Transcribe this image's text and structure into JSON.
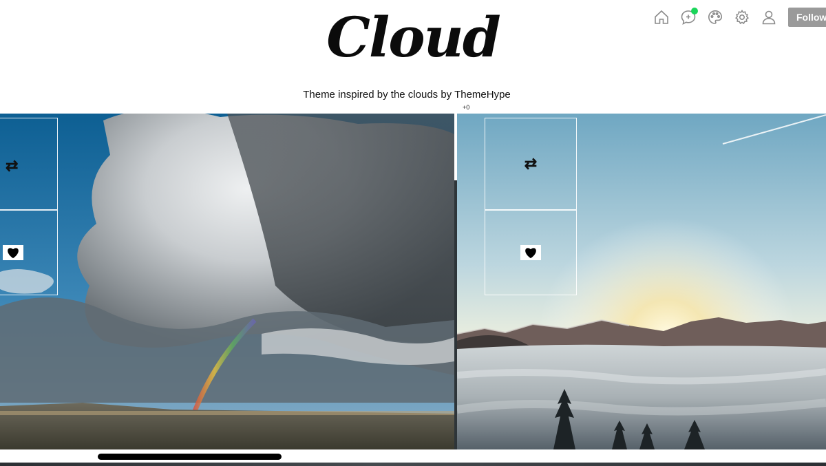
{
  "header": {
    "blog_title": "Cloud",
    "tagline": "Theme inspired by the clouds by ThemeHype",
    "counter": "+0"
  },
  "topnav": {
    "icons": [
      "home-icon",
      "messaging-icon",
      "palette-icon",
      "gear-icon",
      "account-icon"
    ],
    "follow_label": "Follow",
    "notification_dot_color": "#1bd55a"
  },
  "posts": [
    {
      "photo": "storm cloud with rainbow over desert",
      "actions": [
        "reblog",
        "like"
      ]
    },
    {
      "photo": "sunrise over sea of clouds with mountains",
      "actions": [
        "reblog",
        "like"
      ]
    }
  ],
  "colors": {
    "follow_button": "#9a9a9a",
    "background": "#ffffff"
  }
}
